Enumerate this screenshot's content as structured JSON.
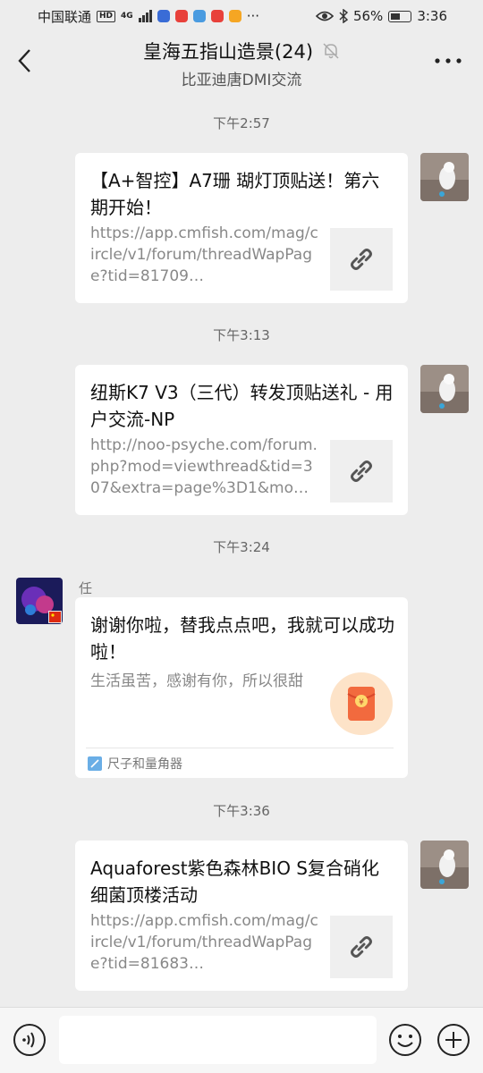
{
  "status_bar": {
    "carrier": "中国联通",
    "network": "HD",
    "net_type": "4G",
    "battery_pct": "56%",
    "time": "3:36"
  },
  "header": {
    "title": "皇海五指山造景(24)",
    "subtitle": "比亚迪唐DMI交流"
  },
  "messages": [
    {
      "time": "下午2:57",
      "title": "【A+智控】A7珊 瑚灯顶贴送！第六期开始！",
      "desc": "https://app.cmfish.com/mag/circle/v1/forum/threadWapPage?tid=81709…"
    },
    {
      "time": "下午3:13",
      "title": "纽斯K7 V3（三代）转发顶贴送礼 - 用户交流-NP",
      "desc": "http://noo-psyche.com/forum.php?mod=viewthread&tid=307&extra=page%3D1&mo…"
    },
    {
      "time": "下午3:24",
      "sender": "任",
      "title": "谢谢你啦，替我点点吧，我就可以成功啦！",
      "desc": "生活虽苦，感谢有你，所以很甜",
      "footer": "尺子和量角器"
    },
    {
      "time": "下午3:36",
      "title": "Aquaforest紫色森林BIO S复合硝化细菌顶楼活动",
      "desc": "https://app.cmfish.com/mag/circle/v1/forum/threadWapPage?tid=81683…"
    }
  ],
  "input": {
    "placeholder": ""
  },
  "colors": {
    "background": "#ededed",
    "card": "#ffffff",
    "red_packet": "#f26a3e"
  }
}
